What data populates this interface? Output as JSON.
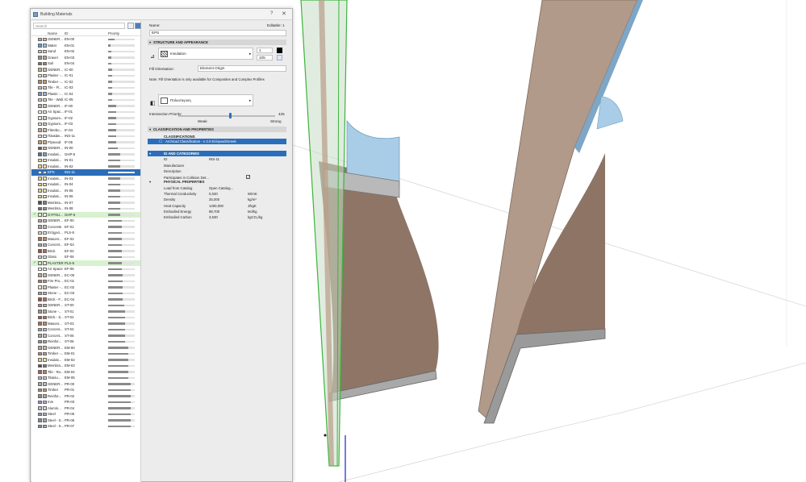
{
  "window": {
    "title": "Building Materials",
    "help_icon": "help-icon",
    "close_icon": "close-icon"
  },
  "library": {
    "search_placeholder": "Search",
    "columns": {
      "name": "Name",
      "id": "ID",
      "priority": "Priority"
    },
    "rows": [
      {
        "name": "GENER...",
        "id": "EN-00",
        "p": 0.25,
        "c1": "#b7a58c",
        "c2": "#c9b8a0"
      },
      {
        "name": "Water",
        "id": "EN-01",
        "p": 0.1,
        "c1": "#5d9cc8",
        "c2": "#8fc1e3"
      },
      {
        "name": "Sand",
        "id": "EN-02",
        "p": 0.12,
        "c1": "#d7bf8c",
        "c2": "#e3cf9e"
      },
      {
        "name": "Gravel",
        "id": "EN-03",
        "p": 0.12,
        "c1": "#9a8f84",
        "c2": "#b1a79c"
      },
      {
        "name": "Soil",
        "id": "EN-04",
        "p": 0.12,
        "c1": "#8a6a4e",
        "c2": "#a1806a"
      },
      {
        "name": "GENER...",
        "id": "IC-00",
        "p": 0.15,
        "c1": "#c6b28e",
        "c2": "#d3c2a3"
      },
      {
        "name": "Plaster -...",
        "id": "IC-01",
        "p": 0.15,
        "c1": "#ede7d7",
        "c2": "#d8cdb4"
      },
      {
        "name": "Timber -...",
        "id": "IC-02",
        "p": 0.15,
        "c1": "#b48757",
        "c2": "#c89a6b"
      },
      {
        "name": "Tile - Fl...",
        "id": "IC-03",
        "p": 0.15,
        "c1": "#c6c1b5",
        "c2": "#dcd6c9"
      },
      {
        "name": "Plastic -...",
        "id": "IC-04",
        "p": 0.15,
        "c1": "#7a93b8",
        "c2": "#9fb3cf"
      },
      {
        "name": "Tile - Wall...",
        "id": "IC-05",
        "p": 0.15,
        "c1": "#d1ccc1",
        "c2": "#e0dbd0"
      },
      {
        "name": "GENER...",
        "id": "IF-00",
        "p": 0.3,
        "c1": "#b9ad97",
        "c2": "#cdc2ad"
      },
      {
        "name": "Air Spac...",
        "id": "IF-01",
        "p": 0.3,
        "c1": "#ffffff",
        "c2": "#eeeeee"
      },
      {
        "name": "Gypsum...",
        "id": "IF-02",
        "p": 0.3,
        "c1": "#e7e3da",
        "c2": "#d4cfc3"
      },
      {
        "name": "Gypsum...",
        "id": "IF-03",
        "p": 0.3,
        "c1": "#e7e3da",
        "c2": "#d4cfc3"
      },
      {
        "name": "Fibrebo...",
        "id": "IF-04",
        "p": 0.3,
        "c1": "#c2a98a",
        "c2": "#d4bf9f"
      },
      {
        "name": "Πλακάκι...",
        "id": "INS-11",
        "p": 0.3,
        "c1": "#e8e4dc",
        "c2": "#f4f2ed"
      },
      {
        "name": "Plywood",
        "id": "IF-05",
        "p": 0.3,
        "c1": "#c79d62",
        "c2": "#d8b07b"
      },
      {
        "name": "GENER...",
        "id": "IN-00",
        "p": 0.35,
        "c1": "#6a5b4e",
        "c2": "#c5b8a8"
      },
      {
        "name": "Insulati...",
        "id": "GHP-5",
        "p": 0.45,
        "c1": "#3e7a9c",
        "c2": "#6da3c2"
      },
      {
        "name": "Insulati...",
        "id": "IN-01",
        "p": 0.45,
        "c1": "#e7d58a",
        "c2": "#efe1a8"
      },
      {
        "name": "Insulati...",
        "id": "IN-02",
        "p": 0.45,
        "c1": "#e7d58a",
        "c2": "#efe1a8"
      },
      {
        "name": "EPS",
        "id": "INS-11",
        "p": 0.5,
        "c1": "#ffffff",
        "c2": "#dddddd",
        "selected": true
      },
      {
        "name": "Insulati...",
        "id": "IN-03",
        "p": 0.45,
        "c1": "#e3cf86",
        "c2": "#ecdda2"
      },
      {
        "name": "Insulati...",
        "id": "IN-04",
        "p": 0.45,
        "c1": "#e3cf86",
        "c2": "#ecdda2"
      },
      {
        "name": "Insulati...",
        "id": "IN-05",
        "p": 0.45,
        "c1": "#e3cf86",
        "c2": "#ecdda2"
      },
      {
        "name": "Insulati...",
        "id": "IN-06",
        "p": 0.45,
        "c1": "#e3cf86",
        "c2": "#ecdda2"
      },
      {
        "name": "Membra...",
        "id": "IN-07",
        "p": 0.45,
        "c1": "#4d4d4d",
        "c2": "#7a7a7a"
      },
      {
        "name": "Membra...",
        "id": "IN-08",
        "p": 0.45,
        "c1": "#6b6b6b",
        "c2": "#909090"
      },
      {
        "name": "GYPSU...",
        "id": "GHP-5",
        "p": 0.45,
        "c1": "#e6e2d8",
        "c2": "#f1eee7",
        "check": true,
        "hl": true
      },
      {
        "name": "GENER...",
        "id": "EF-00",
        "p": 0.5,
        "c1": "#b8a996",
        "c2": "#cbbfae"
      },
      {
        "name": "Concrete",
        "id": "EF-01",
        "p": 0.5,
        "c1": "#a5a5a1",
        "c2": "#bdbdb9"
      },
      {
        "name": "Επίχρισ...",
        "id": "PLS-8",
        "p": 0.5,
        "c1": "#e1dccf",
        "c2": "#ede9df"
      },
      {
        "name": "Masonr...",
        "id": "EF-02",
        "p": 0.5,
        "c1": "#b06c4e",
        "c2": "#c4866a"
      },
      {
        "name": "Concret...",
        "id": "EF-03",
        "p": 0.5,
        "c1": "#a5a5a1",
        "c2": "#bdbdb9"
      },
      {
        "name": "Brick",
        "id": "EF-04",
        "p": 0.5,
        "c1": "#9e4f38",
        "c2": "#b86b52"
      },
      {
        "name": "Glass",
        "id": "EF-05",
        "p": 0.5,
        "c1": "#c6dbe6",
        "c2": "#dfebf1"
      },
      {
        "name": "PLASTER",
        "id": "PLS-9",
        "p": 0.5,
        "c1": "#e1dccf",
        "c2": "#ede9df",
        "check": true,
        "hl": true
      },
      {
        "name": "Air Space",
        "id": "EF-06",
        "p": 0.5,
        "c1": "#ffffff",
        "c2": "#eeeeee"
      },
      {
        "name": "GENER...",
        "id": "EC-00",
        "p": 0.55,
        "c1": "#b6a893",
        "c2": "#c8bda9"
      },
      {
        "name": "Fire Pro...",
        "id": "EC-01",
        "p": 0.55,
        "c1": "#d46a4a",
        "c2": "#e08c70"
      },
      {
        "name": "Plaster -...",
        "id": "EC-02",
        "p": 0.55,
        "c1": "#ede7d7",
        "c2": "#d8cdb4"
      },
      {
        "name": "Stone -...",
        "id": "EC-03",
        "p": 0.55,
        "c1": "#a39c8f",
        "c2": "#b9b3a7"
      },
      {
        "name": "Brick - F...",
        "id": "EC-04",
        "p": 0.55,
        "c1": "#9e4f38",
        "c2": "#b86b52"
      },
      {
        "name": "GENER...",
        "id": "ST-00",
        "p": 0.6,
        "c1": "#9d968b",
        "c2": "#b4aea4"
      },
      {
        "name": "Stone -...",
        "id": "ST-01",
        "p": 0.65,
        "c1": "#9a9285",
        "c2": "#b1aa9e"
      },
      {
        "name": "Brick - S...",
        "id": "ST-02",
        "p": 0.65,
        "c1": "#9e4f38",
        "c2": "#b86b52"
      },
      {
        "name": "Masonr...",
        "id": "ST-03",
        "p": 0.65,
        "c1": "#b06c4e",
        "c2": "#c4866a"
      },
      {
        "name": "Concret...",
        "id": "ST-04",
        "p": 0.65,
        "c1": "#a5a5a1",
        "c2": "#bdbdb9"
      },
      {
        "name": "Concret...",
        "id": "ST-05",
        "p": 0.65,
        "c1": "#a5a5a1",
        "c2": "#bdbdb9"
      },
      {
        "name": "Reinfor...",
        "id": "ST-06",
        "p": 0.65,
        "c1": "#8e8e8a",
        "c2": "#a9a9a5"
      },
      {
        "name": "GENER...",
        "id": "EM-00",
        "p": 0.75,
        "c1": "#b5a793",
        "c2": "#c9bda9"
      },
      {
        "name": "Timber -...",
        "id": "EM-01",
        "p": 0.75,
        "c1": "#b48757",
        "c2": "#c89a6b"
      },
      {
        "name": "Insulati...",
        "id": "EM-02",
        "p": 0.75,
        "c1": "#e3cf86",
        "c2": "#ecdda2"
      },
      {
        "name": "Membra...",
        "id": "EM-03",
        "p": 0.75,
        "c1": "#4d4d4d",
        "c2": "#7a7a7a"
      },
      {
        "name": "Tile - Ro...",
        "id": "EM-04",
        "p": 0.75,
        "c1": "#b55a45",
        "c2": "#c87a66"
      },
      {
        "name": "Titaniu...",
        "id": "EM-05",
        "p": 0.75,
        "c1": "#b9bcc0",
        "c2": "#d1d3d6"
      },
      {
        "name": "GENER...",
        "id": "PR-00",
        "p": 0.85,
        "c1": "#a6a6a6",
        "c2": "#bdbdbd"
      },
      {
        "name": "Timber",
        "id": "PR-01",
        "p": 0.85,
        "c1": "#b48757",
        "c2": "#c89a6b"
      },
      {
        "name": "Reinfor...",
        "id": "PR-02",
        "p": 0.85,
        "c1": "#8e8e8a",
        "c2": "#a9a9a5"
      },
      {
        "name": "mm",
        "id": "PR-03",
        "p": 0.85,
        "c1": "#9b8ac4",
        "c2": "#b7aad6"
      },
      {
        "name": "Alumin...",
        "id": "PR-04",
        "p": 0.85,
        "c1": "#b8bcc3",
        "c2": "#cfd2d7"
      },
      {
        "name": "Steel",
        "id": "PR-05",
        "p": 0.85,
        "c1": "#8b97a6",
        "c2": "#a8b2be"
      },
      {
        "name": "Steel - S...",
        "id": "PR-06",
        "p": 0.85,
        "c1": "#7f8a98",
        "c2": "#9ea7b2"
      },
      {
        "name": "Steel - S...",
        "id": "PR-07",
        "p": 0.85,
        "c1": "#7f8a98",
        "c2": "#9ea7b2"
      }
    ]
  },
  "details": {
    "name_label": "Name:",
    "editable": "Editable: 1",
    "name_value": "EPS",
    "structure_header": "STRUCTURE AND APPEARANCE",
    "fill_value": "Insulation",
    "pen1": "1",
    "pen2": "105",
    "fill_orientation_label": "Fill Orientation:",
    "fill_orientation_value": "Element Origin",
    "note": "Note: Fill Orientation is only available for Composites and Complex Profiles",
    "surface_value": "Πολυστερινη",
    "intersection_label": "Intersection Priority:",
    "intersection_value": "425",
    "weak": "Weak",
    "strong": "Strong",
    "classification_header": "CLASSIFICATION AND PROPERTIES",
    "classifications_label": "CLASSIFICATIONS",
    "classification_value": "Archicad Classification - v 2.0 Ελληνικά/Greek",
    "id_header": "ID AND CATEGORIES",
    "id_rows": [
      {
        "k": "ID",
        "v": "INS-11"
      },
      {
        "k": "Manufacturer",
        "v": ""
      },
      {
        "k": "Description",
        "v": ""
      },
      {
        "k": "Participates in Collision Det...",
        "v": ""
      }
    ],
    "physical_header": "PHYSICAL PROPERTIES",
    "physical_rows": [
      {
        "k": "Load from Catalog",
        "v": "Open Catalog...",
        "u": ""
      },
      {
        "k": "Thermal Conductivity",
        "v": "0,040",
        "u": "W/mK"
      },
      {
        "k": "Density",
        "v": "25,000",
        "u": "kg/m³"
      },
      {
        "k": "Heat Capacity",
        "v": "1400,000",
        "u": "J/kgK"
      },
      {
        "k": "Embodied Energy",
        "v": "88,700",
        "u": "MJ/kg"
      },
      {
        "k": "Embodied Carbon",
        "v": "3,530",
        "u": "kgCO₂/kg"
      }
    ]
  },
  "colors": {
    "accent": "#2a6ebb",
    "wall": "#a48d7c",
    "glass": "#9fc3de",
    "selection": "#3cb43c"
  }
}
